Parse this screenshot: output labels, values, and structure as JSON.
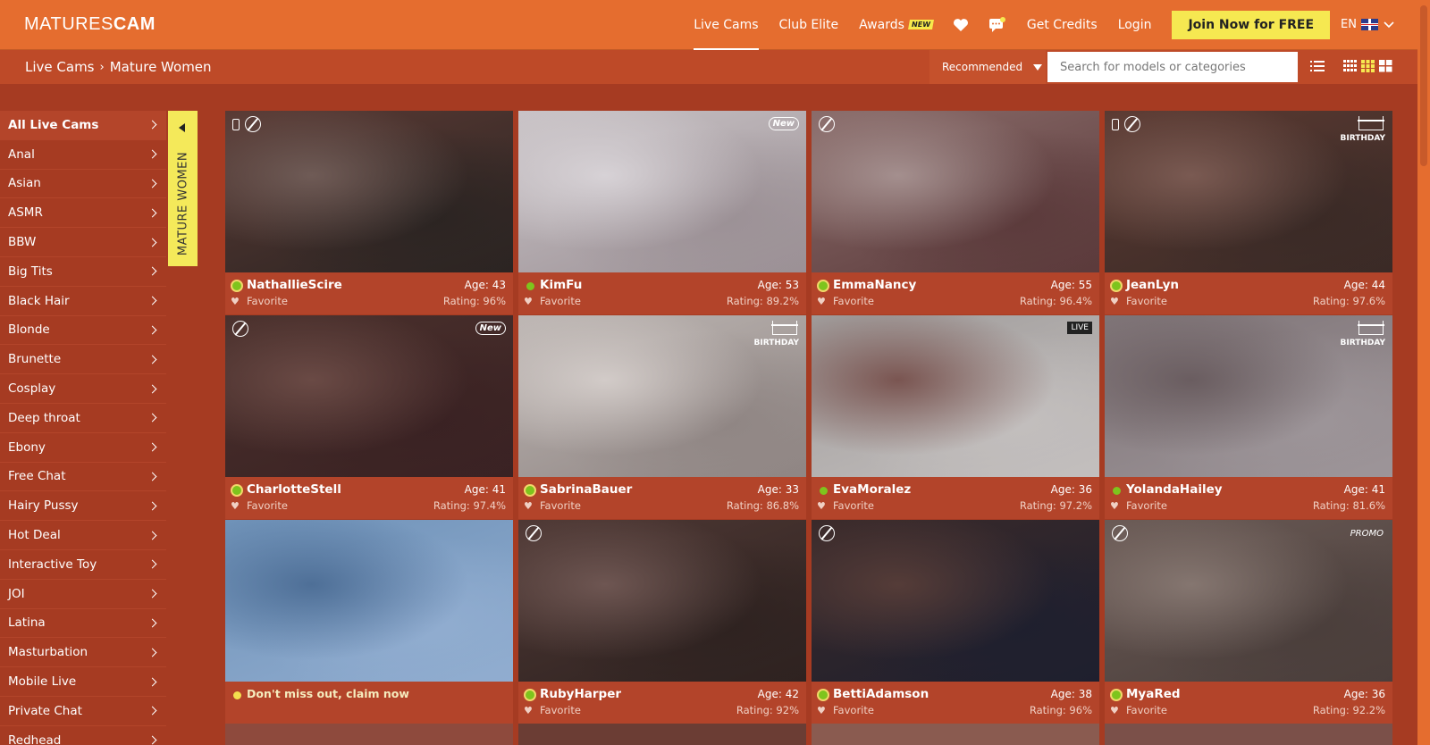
{
  "header": {
    "logo_left": "MATURES",
    "logo_right": "CAM",
    "nav": {
      "live_cams": "Live Cams",
      "club_elite": "Club Elite",
      "awards": "Awards",
      "awards_badge": "NEW",
      "get_credits": "Get Credits",
      "login": "Login"
    },
    "join_label": "Join Now for FREE",
    "lang": "EN"
  },
  "subbar": {
    "crumb_root": "Live Cams",
    "crumb_current": "Mature Women",
    "sort_label": "Recommended",
    "search_placeholder": "Search for models or categories"
  },
  "sidebar": {
    "items": [
      "All Live Cams",
      "Anal",
      "Asian",
      "ASMR",
      "BBW",
      "Big Tits",
      "Black Hair",
      "Blonde",
      "Brunette",
      "Cosplay",
      "Deep throat",
      "Ebony",
      "Free Chat",
      "Hairy Pussy",
      "Hot Deal",
      "Interactive Toy",
      "JOI",
      "Latina",
      "Masturbation",
      "Mobile Live",
      "Private Chat",
      "Redhead"
    ],
    "tab_label": "MATURE WOMEN"
  },
  "favorite_label": "Favorite",
  "cards": [
    {
      "name": "NathallieScire",
      "age": "Age: 43",
      "rating": "Rating: 96%",
      "badge": "",
      "icons": "mobile-nocall",
      "dot": "ring",
      "colors": [
        "#5a3a34",
        "#2b2422",
        "#6f5b56"
      ]
    },
    {
      "name": "KimFu",
      "age": "Age: 53",
      "rating": "Rating: 89.2%",
      "badge": "New",
      "icons": "",
      "dot": "small",
      "colors": [
        "#c9c3c6",
        "#9b9095",
        "#d7d2d6"
      ]
    },
    {
      "name": "EmmaNancy",
      "age": "Age: 55",
      "rating": "Rating: 96.4%",
      "badge": "",
      "icons": "nocall",
      "dot": "ring",
      "colors": [
        "#8a6c6a",
        "#5b3a3b",
        "#a48f8e"
      ]
    },
    {
      "name": "JeanLyn",
      "age": "Age: 44",
      "rating": "Rating: 97.6%",
      "badge": "BIRTHDAY",
      "icons": "mobile-nocall",
      "dot": "ring",
      "colors": [
        "#5b3a32",
        "#3a2a26",
        "#7a5a52"
      ]
    },
    {
      "name": "CharlotteStell",
      "age": "Age: 41",
      "rating": "Rating: 97.4%",
      "badge": "New",
      "icons": "nocall",
      "dot": "ring",
      "colors": [
        "#4a302c",
        "#3a2223",
        "#6a4a45"
      ]
    },
    {
      "name": "SabrinaBauer",
      "age": "Age: 33",
      "rating": "Rating: 86.8%",
      "badge": "BIRTHDAY",
      "icons": "",
      "dot": "ring",
      "colors": [
        "#bdb6b3",
        "#8f8583",
        "#d2cbc8"
      ]
    },
    {
      "name": "EvaMoralez",
      "age": "Age: 36",
      "rating": "Rating: 97.2%",
      "badge": "LIVE",
      "icons": "",
      "dot": "small",
      "colors": [
        "#a09c9b",
        "#c3bfbe",
        "#7a5551"
      ]
    },
    {
      "name": "YolandaHailey",
      "age": "Age: 41",
      "rating": "Rating: 81.6%",
      "badge": "BIRTHDAY",
      "icons": "",
      "dot": "small",
      "colors": [
        "#7f7477",
        "#9d9599",
        "#6a5d60"
      ]
    },
    {
      "name": "",
      "age": "",
      "rating": "",
      "badge": "",
      "icons": "",
      "dot": "yellow",
      "claim": "Don't miss out, claim now",
      "colors": [
        "#6f92b8",
        "#91add0",
        "#4e6f97"
      ]
    },
    {
      "name": "RubyHarper",
      "age": "Age: 42",
      "rating": "Rating: 92%",
      "badge": "",
      "icons": "nocall",
      "dot": "ring",
      "colors": [
        "#4e3834",
        "#2e2220",
        "#6e5652"
      ]
    },
    {
      "name": "BettiAdamson",
      "age": "Age: 38",
      "rating": "Rating: 96%",
      "badge": "",
      "icons": "nocall",
      "dot": "ring",
      "colors": [
        "#3a2a2a",
        "#1e1f2e",
        "#553c38"
      ]
    },
    {
      "name": "MyaRed",
      "age": "Age: 36",
      "rating": "Rating: 92.2%",
      "badge": "PROMO",
      "icons": "nocall",
      "dot": "ring",
      "colors": [
        "#6a5a55",
        "#4a3e3b",
        "#857670"
      ]
    }
  ]
}
